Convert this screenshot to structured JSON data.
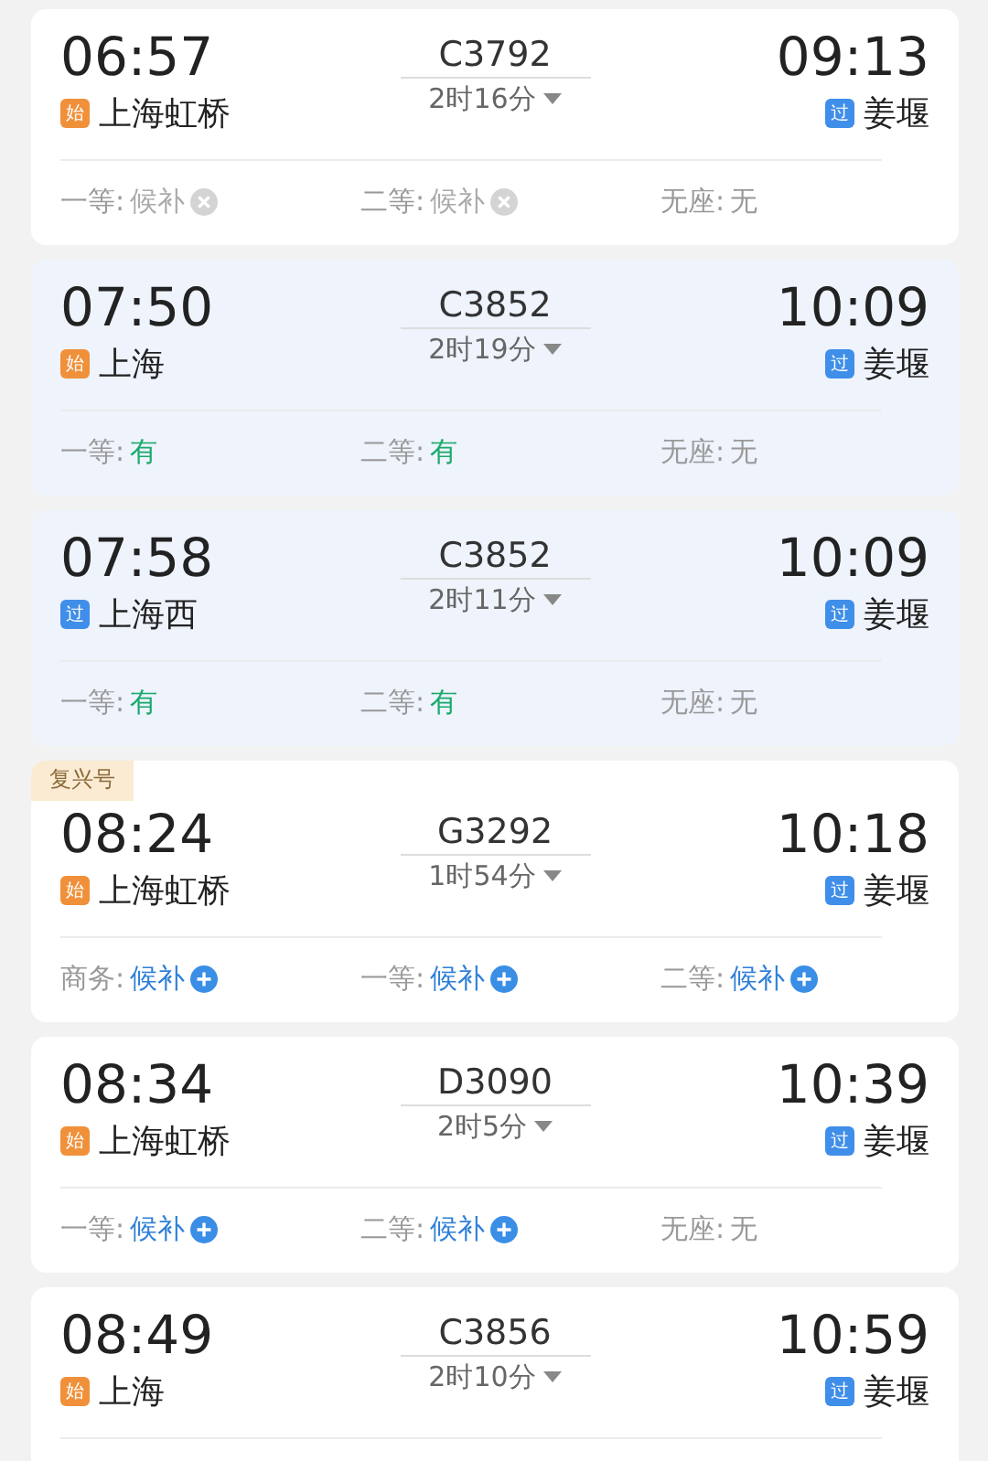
{
  "trains": [
    {
      "depart": "06:57",
      "arrive": "09:13",
      "number": "C3792",
      "duration": "2时16分",
      "from": {
        "tag": "始",
        "kind": "origin",
        "name": "上海虹桥"
      },
      "to": {
        "tag": "过",
        "kind": "pass",
        "name": "姜堰"
      },
      "highlighted": false,
      "seats": [
        {
          "label": "一等:",
          "status": "候补",
          "kind": "waitlist_closed"
        },
        {
          "label": "二等:",
          "status": "候补",
          "kind": "waitlist_closed"
        },
        {
          "label": "无座:",
          "status": "无",
          "kind": "none"
        }
      ]
    },
    {
      "depart": "07:50",
      "arrive": "10:09",
      "number": "C3852",
      "duration": "2时19分",
      "from": {
        "tag": "始",
        "kind": "origin",
        "name": "上海"
      },
      "to": {
        "tag": "过",
        "kind": "pass",
        "name": "姜堰"
      },
      "highlighted": true,
      "seats": [
        {
          "label": "一等:",
          "status": "有",
          "kind": "available"
        },
        {
          "label": "二等:",
          "status": "有",
          "kind": "available"
        },
        {
          "label": "无座:",
          "status": "无",
          "kind": "none"
        }
      ]
    },
    {
      "depart": "07:58",
      "arrive": "10:09",
      "number": "C3852",
      "duration": "2时11分",
      "from": {
        "tag": "过",
        "kind": "pass",
        "name": "上海西"
      },
      "to": {
        "tag": "过",
        "kind": "pass",
        "name": "姜堰"
      },
      "highlighted": true,
      "seats": [
        {
          "label": "一等:",
          "status": "有",
          "kind": "available"
        },
        {
          "label": "二等:",
          "status": "有",
          "kind": "available"
        },
        {
          "label": "无座:",
          "status": "无",
          "kind": "none"
        }
      ]
    },
    {
      "badge": "复兴号",
      "depart": "08:24",
      "arrive": "10:18",
      "number": "G3292",
      "duration": "1时54分",
      "from": {
        "tag": "始",
        "kind": "origin",
        "name": "上海虹桥"
      },
      "to": {
        "tag": "过",
        "kind": "pass",
        "name": "姜堰"
      },
      "highlighted": false,
      "seats": [
        {
          "label": "商务:",
          "status": "候补",
          "kind": "waitlist"
        },
        {
          "label": "一等:",
          "status": "候补",
          "kind": "waitlist"
        },
        {
          "label": "二等:",
          "status": "候补",
          "kind": "waitlist"
        }
      ]
    },
    {
      "depart": "08:34",
      "arrive": "10:39",
      "number": "D3090",
      "duration": "2时5分",
      "from": {
        "tag": "始",
        "kind": "origin",
        "name": "上海虹桥"
      },
      "to": {
        "tag": "过",
        "kind": "pass",
        "name": "姜堰"
      },
      "highlighted": false,
      "seats": [
        {
          "label": "一等:",
          "status": "候补",
          "kind": "waitlist"
        },
        {
          "label": "二等:",
          "status": "候补",
          "kind": "waitlist"
        },
        {
          "label": "无座:",
          "status": "无",
          "kind": "none"
        }
      ]
    },
    {
      "depart": "08:49",
      "arrive": "10:59",
      "number": "C3856",
      "duration": "2时10分",
      "from": {
        "tag": "始",
        "kind": "origin",
        "name": "上海"
      },
      "to": {
        "tag": "过",
        "kind": "pass",
        "name": "姜堰"
      },
      "highlighted": false
    }
  ]
}
